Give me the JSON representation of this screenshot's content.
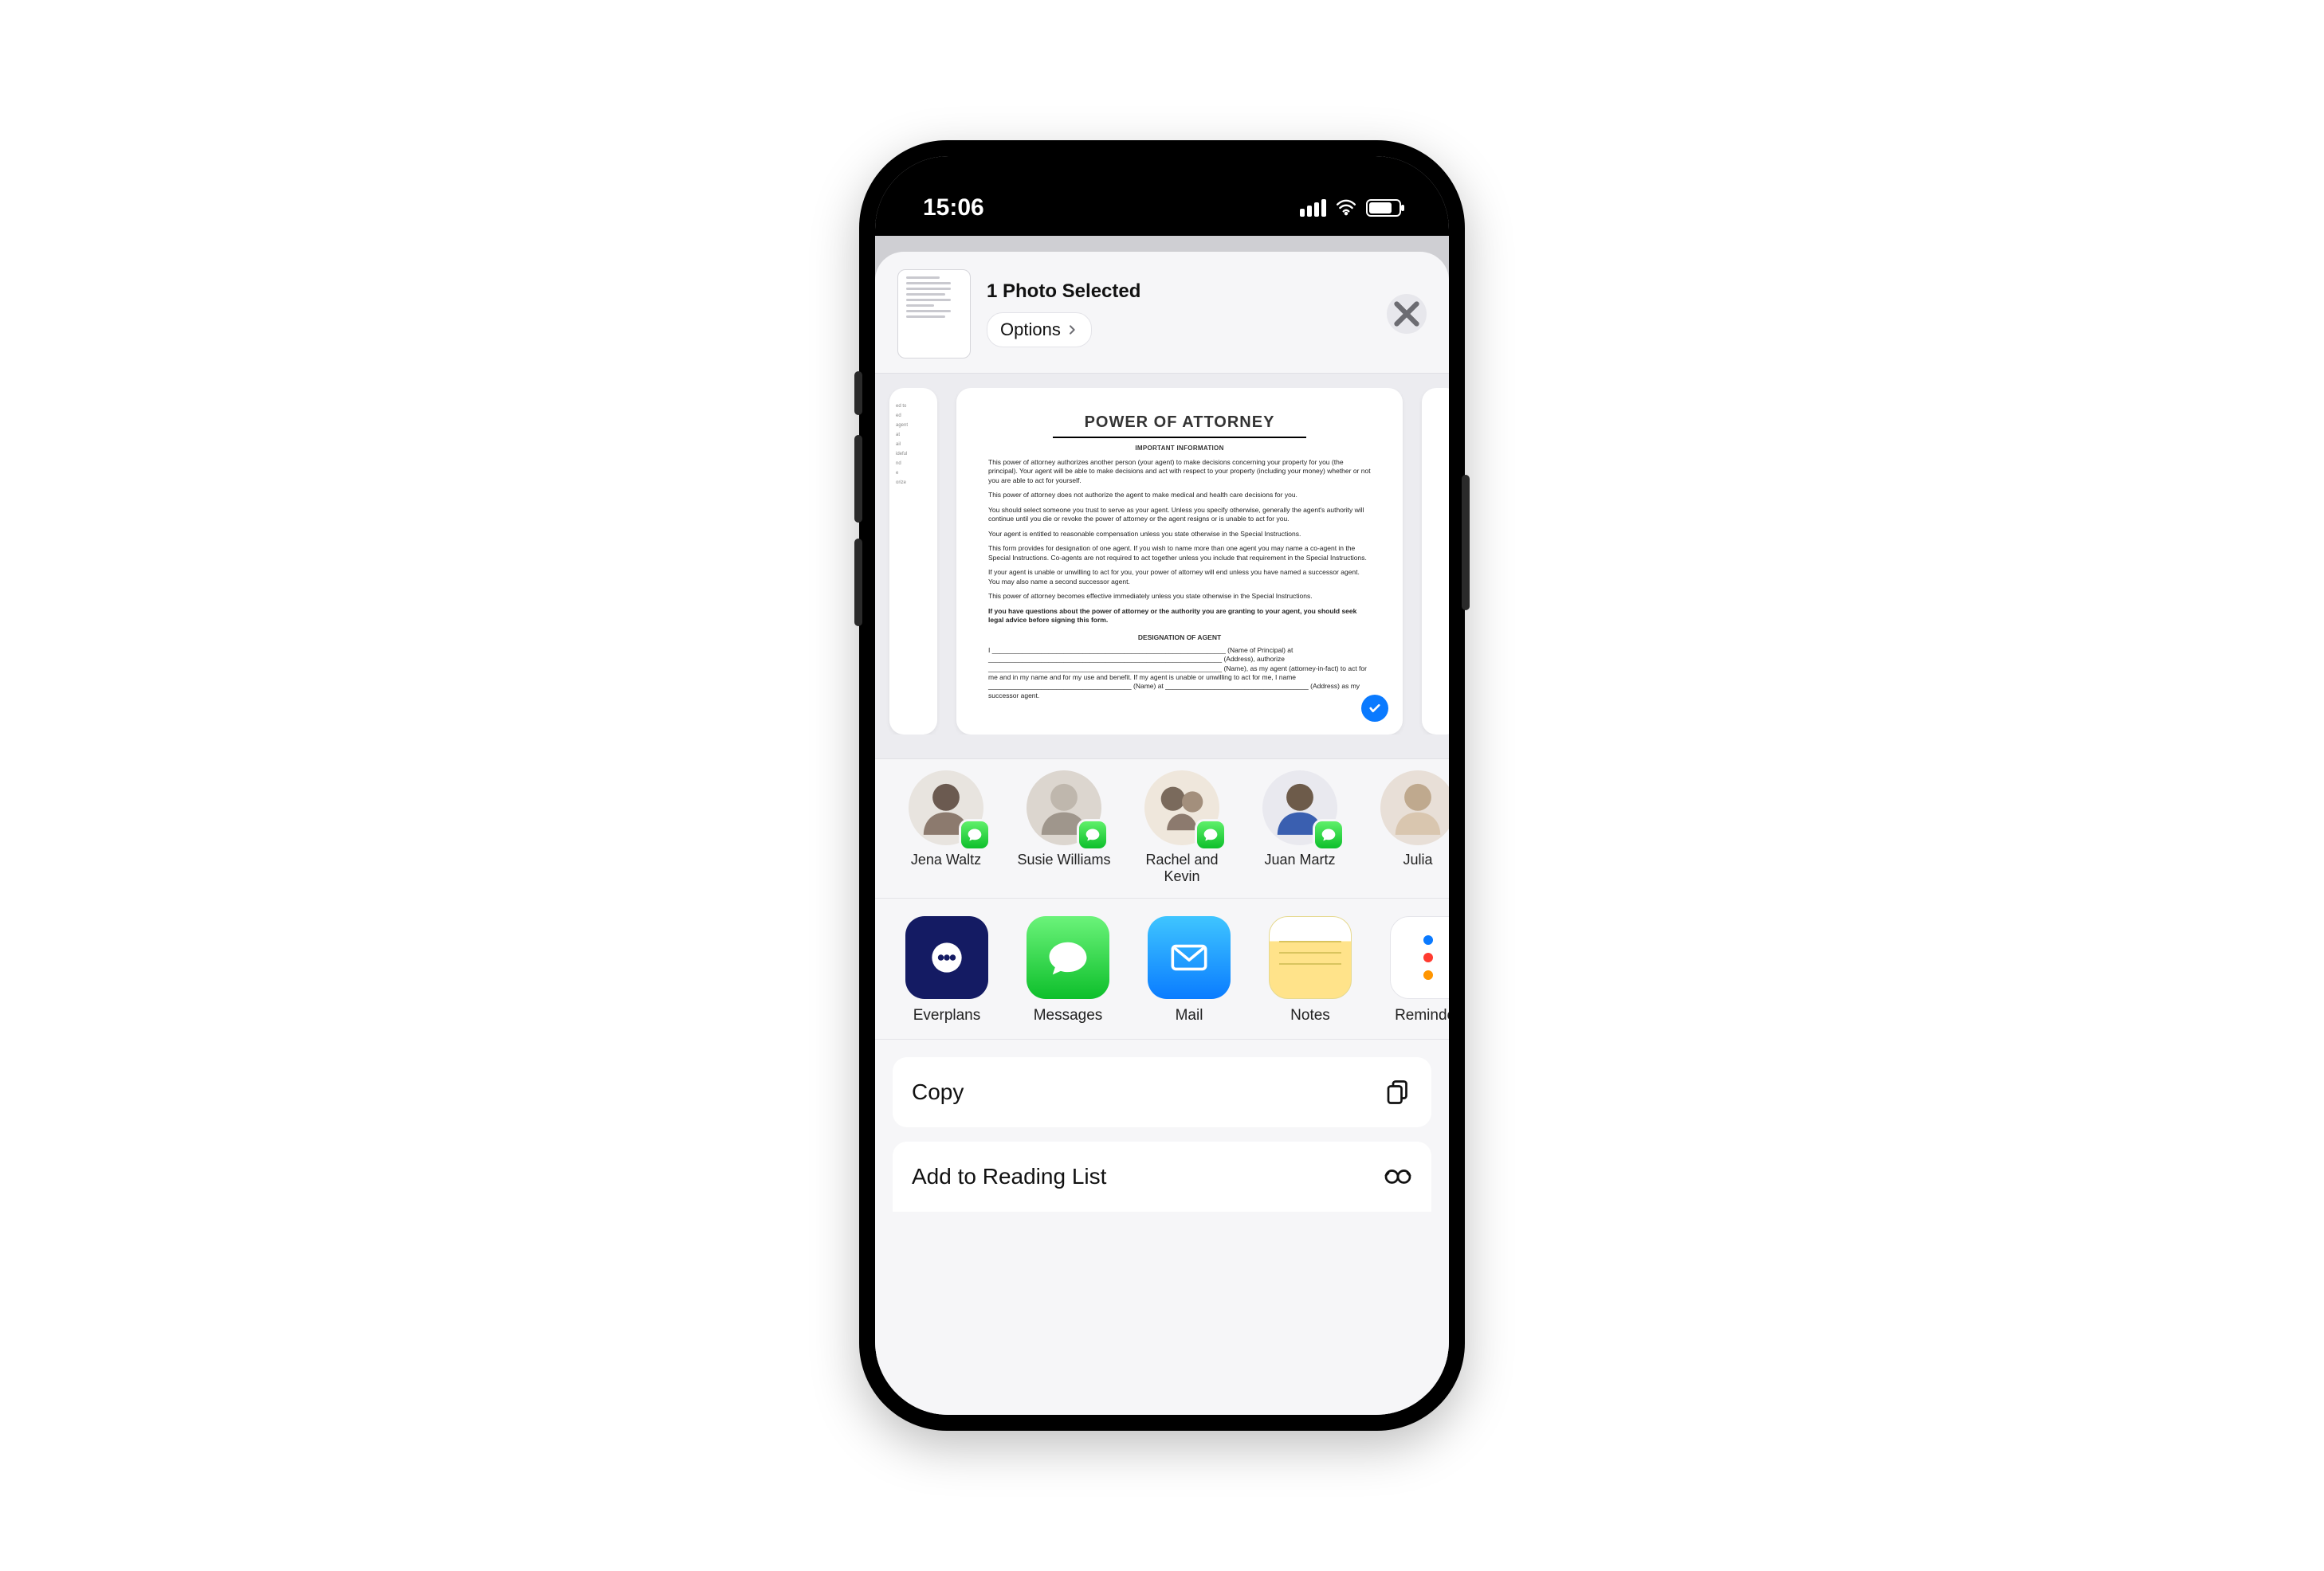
{
  "status": {
    "time": "15:06"
  },
  "header": {
    "selected_label": "1 Photo Selected",
    "options_label": "Options"
  },
  "document": {
    "title": "POWER OF ATTORNEY",
    "subtitle": "IMPORTANT INFORMATION",
    "p1": "This power of attorney authorizes another person (your agent) to make decisions concerning your property for you (the principal). Your agent will be able to make decisions and act with respect to your property (including your money) whether or not you are able to act for yourself.",
    "p2": "This power of attorney does not authorize the agent to make medical and health care decisions for you.",
    "p3": "You should select someone you trust to serve as your agent. Unless you specify otherwise, generally the agent's authority will continue until you die or revoke the power of attorney or the agent resigns or is unable to act for you.",
    "p4": "Your agent is entitled to reasonable compensation unless you state otherwise in the Special Instructions.",
    "p5": "This form provides for designation of one agent. If you wish to name more than one agent you may name a co-agent in the Special Instructions. Co-agents are not required to act together unless you include that requirement in the Special Instructions.",
    "p6": "If your agent is unable or unwilling to act for you, your power of attorney will end unless you have named a successor agent. You may also name a second successor agent.",
    "p7": "This power of attorney becomes effective immediately unless you state otherwise in the Special Instructions.",
    "p8": "If you have questions about the power of attorney or the authority you are granting to your agent, you should seek legal advice before signing this form.",
    "designation_heading": "DESIGNATION OF AGENT",
    "d1": "I ______________________________________________________________ (Name of Principal) at ______________________________________________________________ (Address), authorize ______________________________________________________________ (Name), as my agent (attorney-in-fact) to act for me and in my name and for my use and benefit. If my agent is unable or unwilling to act for me, I name ______________________________________ (Name) at ______________________________________ (Address) as my successor agent."
  },
  "contacts": [
    {
      "name": "Jena Waltz"
    },
    {
      "name": "Susie Williams"
    },
    {
      "name": "Rachel and Kevin"
    },
    {
      "name": "Juan Martz"
    },
    {
      "name": "Julia"
    }
  ],
  "apps": [
    {
      "name": "Everplans"
    },
    {
      "name": "Messages"
    },
    {
      "name": "Mail"
    },
    {
      "name": "Notes"
    },
    {
      "name": "Reminders"
    }
  ],
  "actions": {
    "copy": "Copy",
    "reading_list": "Add to Reading List"
  }
}
